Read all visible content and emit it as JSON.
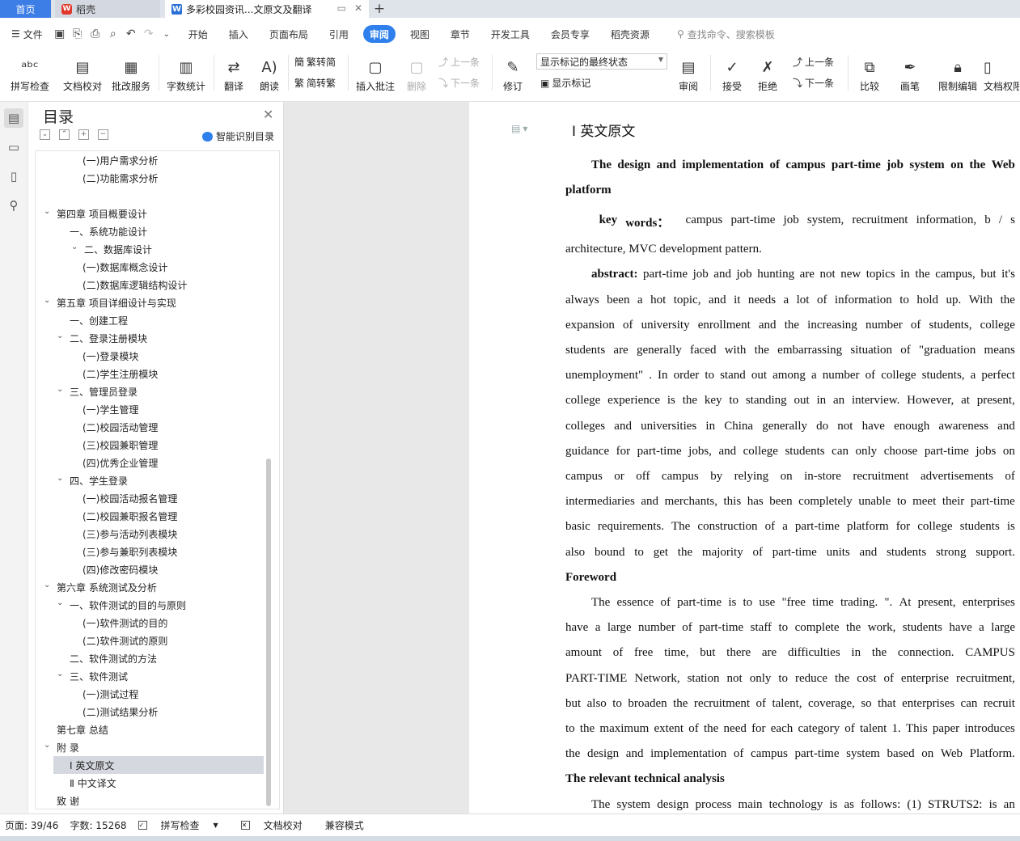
{
  "tabs": {
    "home": "首页",
    "wps": "稻壳",
    "doc": "多彩校园资讯...文原文及翻译"
  },
  "menu": {
    "file": "文件",
    "items": [
      "开始",
      "插入",
      "页面布局",
      "引用",
      "审阅",
      "视图",
      "章节",
      "开发工具",
      "会员专享",
      "稻壳资源"
    ],
    "active": "审阅",
    "search": "查找命令、搜索模板"
  },
  "ribbon": {
    "spell": "拼写检查",
    "proof": "文档校对",
    "batch": "批改服务",
    "wordcount": "字数统计",
    "translate": "翻译",
    "read": "朗读",
    "t2s": "繁转简",
    "s2t": "简转繁",
    "insert_comment": "插入批注",
    "delete": "删除",
    "prev_c": "上一条",
    "next_c": "下一条",
    "track": "修订",
    "markup_select": "显示标记的最终状态",
    "show_markup": "显示标记",
    "review": "审阅",
    "accept": "接受",
    "reject": "拒绝",
    "prev": "上一条",
    "next": "下一条",
    "compare": "比较",
    "pen": "画笔",
    "restrict": "限制编辑",
    "perm": "文档权限"
  },
  "nav": {
    "title": "目录",
    "ai_label": "智能识别目录"
  },
  "toc": [
    {
      "text": "(一)用户需求分析",
      "indent": 3,
      "chev": false
    },
    {
      "text": "(二)功能需求分析",
      "indent": 3,
      "chev": false
    },
    {
      "text": "",
      "indent": 0,
      "chev": false
    },
    {
      "text": "第四章  项目概要设计",
      "indent": 1,
      "chev": true
    },
    {
      "text": "一、系统功能设计",
      "indent": 2,
      "chev": false
    },
    {
      "text": "二、数据库设计",
      "indent": 2.8,
      "chev": true
    },
    {
      "text": "(一)数据库概念设计",
      "indent": 3,
      "chev": false
    },
    {
      "text": "(二)数据库逻辑结构设计",
      "indent": 3,
      "chev": false
    },
    {
      "text": "第五章  项目详细设计与实现",
      "indent": 1,
      "chev": true
    },
    {
      "text": "一、创建工程",
      "indent": 2,
      "chev": false
    },
    {
      "text": "二、登录注册模块",
      "indent": 2,
      "chev": true
    },
    {
      "text": "(一)登录模块",
      "indent": 3,
      "chev": false
    },
    {
      "text": "(二)学生注册模块",
      "indent": 3,
      "chev": false
    },
    {
      "text": "三、管理员登录",
      "indent": 2,
      "chev": true
    },
    {
      "text": "(一)学生管理",
      "indent": 3,
      "chev": false
    },
    {
      "text": "(二)校园活动管理",
      "indent": 3,
      "chev": false
    },
    {
      "text": "(三)校园兼职管理",
      "indent": 3,
      "chev": false
    },
    {
      "text": "(四)优秀企业管理",
      "indent": 3,
      "chev": false
    },
    {
      "text": "四、学生登录",
      "indent": 2,
      "chev": true
    },
    {
      "text": "(一)校园活动报名管理",
      "indent": 3,
      "chev": false
    },
    {
      "text": "(二)校园兼职报名管理",
      "indent": 3,
      "chev": false
    },
    {
      "text": "(三)参与活动列表模块",
      "indent": 3,
      "chev": false
    },
    {
      "text": "(三)参与兼职列表模块",
      "indent": 3,
      "chev": false
    },
    {
      "text": "(四)修改密码模块",
      "indent": 3,
      "chev": false
    },
    {
      "text": "第六章  系统测试及分析",
      "indent": 1,
      "chev": true
    },
    {
      "text": "一、软件测试的目的与原则",
      "indent": 2,
      "chev": true
    },
    {
      "text": "(一)软件测试的目的",
      "indent": 3,
      "chev": false
    },
    {
      "text": "(二)软件测试的原则",
      "indent": 3,
      "chev": false
    },
    {
      "text": "二、软件测试的方法",
      "indent": 2,
      "chev": false
    },
    {
      "text": "三、软件测试",
      "indent": 2,
      "chev": true
    },
    {
      "text": "(一)测试过程",
      "indent": 3,
      "chev": false
    },
    {
      "text": "(二)测试结果分析",
      "indent": 3,
      "chev": false
    },
    {
      "text": "第七章  总结",
      "indent": 1,
      "chev": false
    },
    {
      "text": "附    录",
      "indent": 1,
      "chev": true
    },
    {
      "text": "Ⅰ  英文原文",
      "indent": 2,
      "chev": false,
      "sel": true
    },
    {
      "text": "Ⅱ  中文译文",
      "indent": 2,
      "chev": false
    },
    {
      "text": "致    谢",
      "indent": 1,
      "chev": false
    }
  ],
  "doc": {
    "heading": "Ⅰ  英文原文",
    "lines": [
      {
        "t": "The design and implementation of campus part-time job system on the Web",
        "b": "all",
        "ind": 2
      },
      {
        "t": "platform",
        "b": "all",
        "last": true
      },
      {
        "t": "key words：  campus part-time job system, recruitment information, b / s",
        "b": "key words：",
        "ind": 2.6
      },
      {
        "t": "architecture, MVC development pattern.",
        "last": true
      },
      {
        "t": "abstract: part-time job and job hunting are not new topics in the campus, but it's",
        "b": "abstract",
        "ind": 2
      },
      {
        "t": "always been a hot topic, and it needs a lot of information to hold up. With the"
      },
      {
        "t": "expansion of university enrollment and the increasing number of students, college"
      },
      {
        "t": "students are generally faced with the embarrassing situation of \"graduation means"
      },
      {
        "t": "unemployment\" . In order to stand out among a number of college students, a perfect"
      },
      {
        "t": "college experience is the key to standing out in an interview. However, at present,"
      },
      {
        "t": "colleges and universities in China generally do not have enough awareness and"
      },
      {
        "t": "guidance for part-time jobs, and college students can only choose part-time jobs on"
      },
      {
        "t": "campus or off campus by relying on in-store recruitment advertisements of"
      },
      {
        "t": "intermediaries and merchants, this has been completely unable to meet their part-time"
      },
      {
        "t": "basic requirements. The construction of a part-time platform for college students is"
      },
      {
        "t": "also bound to get the majority of part-time units and students strong support."
      },
      {
        "t": "Foreword",
        "b": "all",
        "last": true
      },
      {
        "t": "The essence of part-time is to use \"free time trading. \". At present, enterprises",
        "ind": 2
      },
      {
        "t": "have a large number of part-time staff to complete the work, students have a large"
      },
      {
        "t": "amount of free time, but there are difficulties in the connection. CAMPUS"
      },
      {
        "t": "PART-TIME Network, station not only to reduce the cost of enterprise recruitment,"
      },
      {
        "t": "but also to broaden the recruitment of talent, coverage, so that enterprises can recruit"
      },
      {
        "t": "to the maximum extent of the need for each category of talent 1. This paper introduces"
      },
      {
        "t": "the design and implementation of campus part-time system based on Web Platform."
      },
      {
        "t": "The relevant technical analysis",
        "b": "all",
        "last": true
      },
      {
        "t": "The system design process main technology is as follows: (1) STRUTS2: is an",
        "ind": 2
      }
    ]
  },
  "status": {
    "page": "页面: 39/46",
    "words": "字数: 15268",
    "spell": "拼写检查",
    "proof": "文档校对",
    "compat": "兼容模式"
  }
}
